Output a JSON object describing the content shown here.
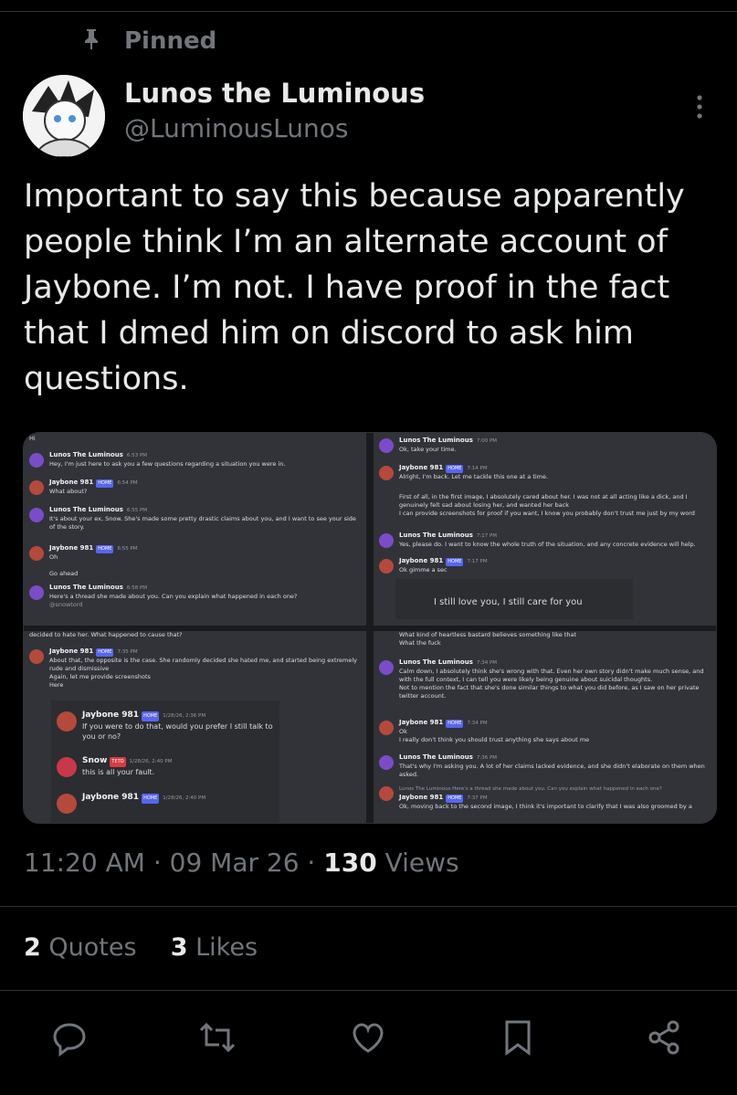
{
  "pinned_label": "Pinned",
  "author": {
    "name": "Lunos the Luminous",
    "handle": "@LuminousLunos"
  },
  "post_text": "Important to say this because apparently people think I’m an alternate account of Jaybone. I’m not. I have proof in the fact that I dmed him on discord to ask him questions.",
  "media": {
    "panel1": {
      "header": "Hi",
      "messages": [
        {
          "user": "Lunos The Luminous",
          "time": "6:53 PM",
          "text": "Hey, I'm just here to ask you a few questions regarding a situation you were in."
        },
        {
          "user": "Jaybone 981",
          "tag": "HOME",
          "time": "6:54 PM",
          "text": "What about?"
        },
        {
          "user": "Lunos The Luminous",
          "time": "6:55 PM",
          "text": "It's about your ex, Snow. She's made some pretty drastic claims about you, and I want to see your side of the story."
        },
        {
          "user": "Jaybone 981",
          "tag": "HOME",
          "time": "6:55 PM",
          "text": "Oh",
          "text2": "Go ahead"
        },
        {
          "user": "Lunos The Luminous",
          "time": "6:58 PM",
          "text": "Here's a thread she made about you. Can you explain what happened in each one?",
          "text2": "@snowtord"
        }
      ]
    },
    "panel2": {
      "messages": [
        {
          "user": "Lunos The Luminous",
          "time": "7:00 PM",
          "text": "Ok, take your time."
        },
        {
          "user": "Jaybone 981",
          "tag": "HOME",
          "time": "7:14 PM",
          "text": "Alright, I'm back. Let me tackle this one at a time."
        },
        {
          "text": "First of all, in the first image, I absolutely cared about her. I was not at all acting like a dick, and I genuinely felt sad about losing her, and wanted her back"
        },
        {
          "text": "I can provide screenshots for proof if you want, I know you probably don't trust me just by my word"
        },
        {
          "user": "Lunos The Luminous",
          "time": "7:17 PM",
          "text": "Yes, please do. I want to know the whole truth of the situation, and any concrete evidence will help."
        },
        {
          "user": "Jaybone 981",
          "tag": "HOME",
          "time": "7:17 PM",
          "text": "Ok gimme a sec"
        }
      ],
      "embed_text": "I still love you, I still care for you"
    },
    "panel3": {
      "header": "decided to hate her. What happened to cause that?",
      "messages": [
        {
          "user": "Jaybone 981",
          "tag": "HOME",
          "time": "7:35 PM",
          "text": "About that, the opposite is the case. She randomly decided she hated me, and started being extremely rude and dismissive",
          "text2": "Again, let me provide screenshots",
          "text3": "Here"
        }
      ],
      "embed": [
        {
          "user": "Jaybone 981",
          "tag": "HOME",
          "time": "1/28/26, 2:36 PM",
          "text": "If you were to do that, would you prefer I still talk to you or no?"
        },
        {
          "user": "Snow",
          "tag": "TETO",
          "time": "1/28/26, 2:40 PM",
          "text": "this is all your fault."
        },
        {
          "user": "Jaybone 981",
          "tag": "HOME",
          "time": "1/28/26, 2:40 PM",
          "text": ""
        }
      ]
    },
    "panel4": {
      "header": "What kind of heartless bastard believes something like that",
      "header2": "What the fuck",
      "messages": [
        {
          "user": "Lunos The Luminous",
          "time": "7:34 PM",
          "text": "Calm down, I absolutely think she's wrong with that. Even her own story didn't make much sense, and with the full context, I can tell you were likely being genuine about suicidal thoughts.",
          "text2": "Not to mention the fact that she's done similar things to what you did before, as I saw on her private twitter account."
        },
        {
          "user": "Jaybone 981",
          "tag": "HOME",
          "time": "7:34 PM",
          "text": "Ok",
          "text2": "I really don't think you should trust anything she says about me"
        },
        {
          "user": "Lunos The Luminous",
          "time": "7:36 PM",
          "text": "That's why I'm asking you. A lot of her claims lacked evidence, and she didn't elaborate on them when asked."
        },
        {
          "reply": "Lunos The Luminous Here's a thread she made about you. Can you explain what happened in each one?",
          "user": "Jaybone 981",
          "tag": "HOME",
          "time": "7:37 PM",
          "text": "Ok, moving back to the second image, I think it's important to clarify that I was also groomed by a"
        }
      ]
    }
  },
  "meta": {
    "time": "11:20 AM",
    "date": "09 Mar 26",
    "views_count": "130",
    "views_label": "Views"
  },
  "stats": {
    "quotes_count": "2",
    "quotes_label": "Quotes",
    "likes_count": "3",
    "likes_label": "Likes"
  }
}
